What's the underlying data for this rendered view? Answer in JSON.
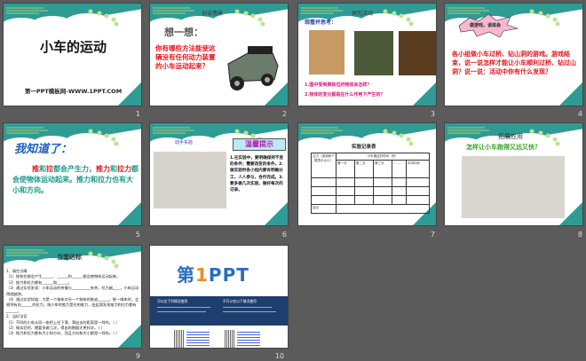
{
  "slides": [
    {
      "number": "1",
      "title": "小车的运动",
      "footer": "第一PPT模板网-WWW.1PPT.COM"
    },
    {
      "number": "2",
      "header": "创设情景",
      "subtitle": "想一想：",
      "question": "你有哪些方法能使这辆没有任何动力装置的小车运动起来？"
    },
    {
      "number": "3",
      "header": "探究活动",
      "prompt": "观看并思考：",
      "q1": "1.图中受到推和拉的物体会怎样？",
      "q2": "2.物体的变化都是在什么作用下产生的？"
    },
    {
      "number": "4",
      "banner": "做游戏，谈体会",
      "body": "各小组做小车过桥、钻山洞的游戏。游戏结束，说一说怎样才能让小车顺利过桥、钻过山洞？说一说：活动中你有什么发现？"
    },
    {
      "number": "5",
      "title": "我知道了：",
      "w1": "推",
      "w2": "和",
      "w3": "拉",
      "w4": "都会产生力，",
      "w5": "推力",
      "w6": "和",
      "w7": "拉力",
      "w8": "都会使物体运动起来。推力和拉力也有大小和方向。"
    },
    {
      "number": "6",
      "header": "动手实验",
      "tip_title": "温馨提示",
      "tips": "1.在实验中，要明确保持不变的条件；需要改变的条件。2.做实验时各小组内要有明确分工，人人参与，合作完成。3.要多做几次实验，做好每次的记录。"
    },
    {
      "number": "7",
      "title": "实验记录表",
      "col0": "拉力（用钩码个数表示大小）",
      "col_group": "小车通过的时间（秒）",
      "cols": [
        "第一次",
        "第二次",
        "第三次",
        "……",
        "平均时间"
      ],
      "conclusion": "结论"
    },
    {
      "number": "8",
      "header": "拓展应用",
      "question": "怎样让小车跑得又远又快？"
    },
    {
      "number": "9",
      "header": "当堂达标",
      "lines": [
        "1、填空点睛",
        "（1）推和拉都会产生______、______和______都会使物体运动起来。",
        "（2）推力和拉力都有______和______。",
        "（3）通过实验发现：小车运动的快慢与__________有关，拉力越____，小车运动得就越快。",
        "（4）通过实验知道：力是一个物体对另一个物体的推或______，推一辆车时，会感到有向______的拉力，推小车时推力是往的推力，由此我发现推力和拉力都有______。",
        "2、当好法官",
        "（1）不同的小车从同一座桥上往下滑，滑出去的距离是一样的。（ ）",
        "（2）做实验时，需要多做几次，得出的数据才更科学。（ ）",
        "（3）推力和拉力都有大小和方向，而且方向和大小都是一样的。（ ）"
      ]
    },
    {
      "number": "10",
      "logo": "第1PPT",
      "left_title": "可以在下列情况使用",
      "right_title": "不可以在以下情况使用"
    }
  ],
  "colors": {
    "background": "#5b5b5b",
    "teal": "#2e9c95",
    "red": "#e8141b",
    "blue": "#1f5fbf"
  }
}
